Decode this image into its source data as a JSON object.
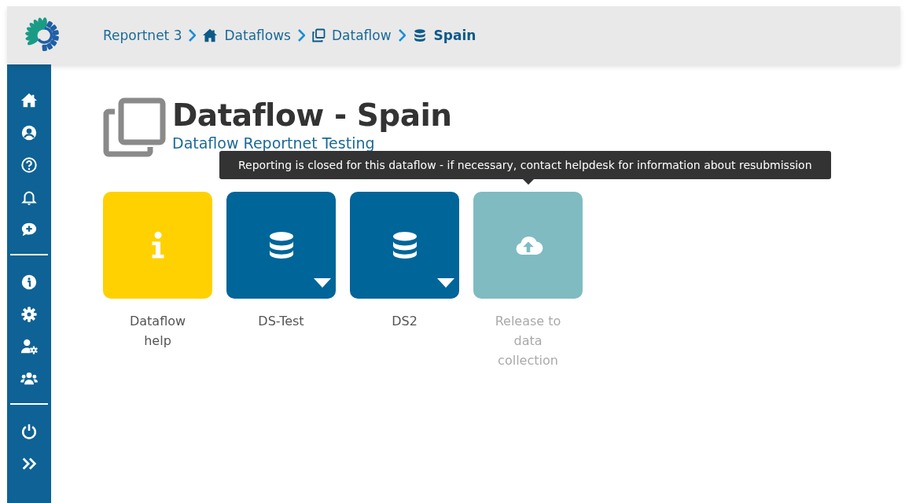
{
  "breadcrumb": [
    {
      "label": "Reportnet 3",
      "kind": "text",
      "current": false
    },
    {
      "label": "Dataflows",
      "kind": "home",
      "current": false
    },
    {
      "label": "Dataflow",
      "kind": "copy",
      "current": false
    },
    {
      "label": "Spain",
      "kind": "database",
      "current": true
    }
  ],
  "page": {
    "title": "Dataflow - Spain",
    "subtitle": "Dataflow Reportnet Testing"
  },
  "tooltip": "Reporting is closed for this dataflow - if necessary, contact helpdesk for information about resubmission",
  "cards": [
    {
      "label": "Dataflow help",
      "kind": "help",
      "disabled": false
    },
    {
      "label": "DS-Test",
      "kind": "dataset",
      "disabled": false
    },
    {
      "label": "DS2",
      "kind": "dataset",
      "disabled": false
    },
    {
      "label": "Release to data collection",
      "kind": "release",
      "disabled": true
    }
  ]
}
